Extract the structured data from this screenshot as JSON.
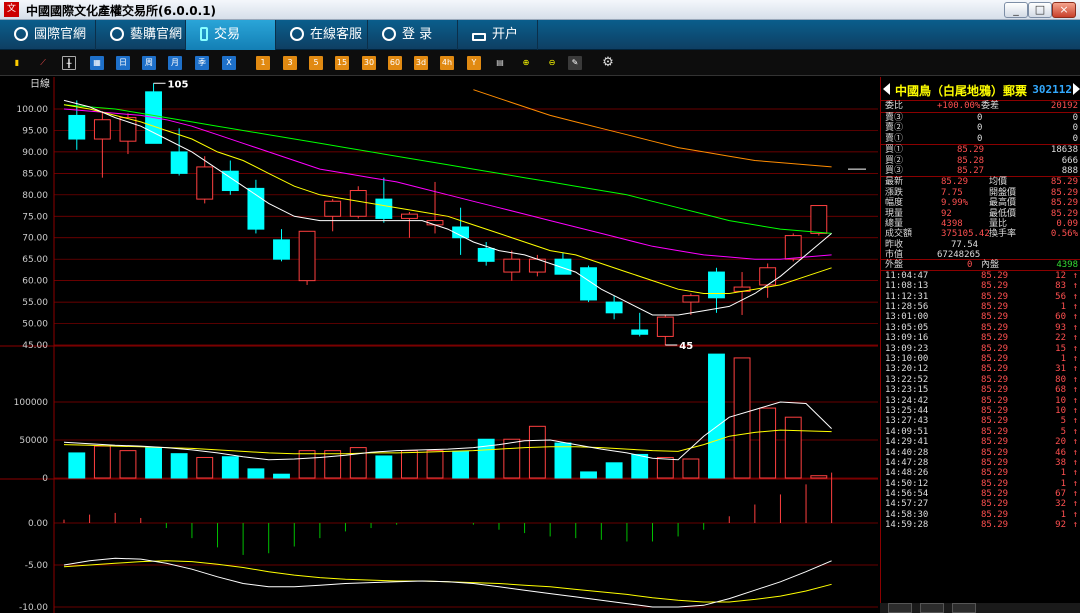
{
  "window": {
    "title": "中國國際文化產權交易所(6.0.0.1)",
    "app_icon_text": "文"
  },
  "nav": {
    "tabs": [
      {
        "label": "國際官網"
      },
      {
        "label": "藝購官網"
      },
      {
        "label": "交易"
      },
      {
        "label": "在線客服"
      },
      {
        "label": "登  录"
      },
      {
        "label": "开户"
      }
    ]
  },
  "toolbar": {
    "period_buttons": [
      "日",
      "周",
      "月",
      "季",
      "X"
    ],
    "minute_buttons": [
      "1",
      "3",
      "5",
      "15",
      "30",
      "60",
      "3d",
      "4h",
      "Y"
    ]
  },
  "chart": {
    "period_label": "日線",
    "max_label": "105",
    "min_label": "45",
    "y_ticks_price": [
      "100.00",
      "95.00",
      "90.00",
      "85.00",
      "80.00",
      "75.00",
      "70.00",
      "65.00",
      "60.00",
      "55.00",
      "50.00",
      "45.00"
    ],
    "y_ticks_volume": [
      "100000",
      "50000",
      "0"
    ],
    "y_ticks_macd": [
      "0.00",
      "-5.00",
      "-10.00"
    ]
  },
  "colors": {
    "rise": "#ff4040",
    "fall": "#00ffff",
    "ma5": "#ffffff",
    "ma10": "#ffff00",
    "ma20": "#ff00ff",
    "ma30": "#00ff00",
    "ma60": "#ff8c00",
    "grid": "#8b0000"
  },
  "chart_data": {
    "type": "candlestick",
    "title": "",
    "price_axis": [
      45,
      100
    ],
    "candles": [
      {
        "open": 98.5,
        "high": 102.0,
        "low": 90.5,
        "close": 93.0
      },
      {
        "open": 93.0,
        "high": 99.5,
        "low": 84.0,
        "close": 97.5
      },
      {
        "open": 92.5,
        "high": 99.0,
        "low": 89.5,
        "close": 98.0
      },
      {
        "open": 104.0,
        "high": 106.0,
        "low": 93.0,
        "close": 92.0
      },
      {
        "open": 90.0,
        "high": 95.5,
        "low": 84.5,
        "close": 85.0
      },
      {
        "open": 79.0,
        "high": 89.0,
        "low": 78.0,
        "close": 86.5
      },
      {
        "open": 85.5,
        "high": 88.0,
        "low": 80.0,
        "close": 81.0
      },
      {
        "open": 81.5,
        "high": 83.5,
        "low": 71.0,
        "close": 72.0
      },
      {
        "open": 69.5,
        "high": 72.0,
        "low": 64.5,
        "close": 65.0
      },
      {
        "open": 60.0,
        "high": 71.5,
        "low": 59.0,
        "close": 71.5
      },
      {
        "open": 75.0,
        "high": 79.0,
        "low": 71.5,
        "close": 78.5
      },
      {
        "open": 75.0,
        "high": 82.0,
        "low": 74.5,
        "close": 81.0
      },
      {
        "open": 79.0,
        "high": 84.0,
        "low": 73.5,
        "close": 74.5
      },
      {
        "open": 74.5,
        "high": 76.0,
        "low": 70.0,
        "close": 75.5
      },
      {
        "open": 73.0,
        "high": 83.0,
        "low": 71.0,
        "close": 74.0
      },
      {
        "open": 72.5,
        "high": 77.0,
        "low": 66.0,
        "close": 70.0
      },
      {
        "open": 67.5,
        "high": 69.0,
        "low": 63.5,
        "close": 64.5
      },
      {
        "open": 62.0,
        "high": 67.0,
        "low": 60.0,
        "close": 65.0
      },
      {
        "open": 62.0,
        "high": 66.0,
        "low": 61.0,
        "close": 65.0
      },
      {
        "open": 65.0,
        "high": 66.5,
        "low": 61.5,
        "close": 61.5
      },
      {
        "open": 63.0,
        "high": 63.5,
        "low": 55.0,
        "close": 55.5
      },
      {
        "open": 55.0,
        "high": 56.5,
        "low": 51.0,
        "close": 52.5
      },
      {
        "open": 48.5,
        "high": 52.5,
        "low": 47.0,
        "close": 47.5
      },
      {
        "open": 47.0,
        "high": 52.0,
        "low": 45.0,
        "close": 51.5
      },
      {
        "open": 55.0,
        "high": 57.0,
        "low": 52.0,
        "close": 56.5
      },
      {
        "open": 62.0,
        "high": 63.0,
        "low": 52.5,
        "close": 56.0
      },
      {
        "open": 57.5,
        "high": 62.0,
        "low": 52.0,
        "close": 58.5
      },
      {
        "open": 59.0,
        "high": 64.0,
        "low": 56.0,
        "close": 63.0
      },
      {
        "open": 65.0,
        "high": 71.0,
        "low": 64.5,
        "close": 70.5
      },
      {
        "open": 71.0,
        "high": 77.5,
        "low": 70.5,
        "close": 77.5
      }
    ],
    "volumes": [
      33000,
      42000,
      36000,
      40000,
      32000,
      27000,
      28000,
      12000,
      5000,
      36000,
      36000,
      40000,
      29000,
      36000,
      36000,
      35000,
      51000,
      51000,
      68000,
      46000,
      8000,
      20000,
      31000,
      27000,
      25000,
      163000,
      158000,
      92000,
      80000,
      3000
    ],
    "ma_price": {
      "ma5": [
        102,
        100.5,
        98,
        96,
        93,
        90,
        86,
        82,
        78,
        75,
        74,
        74,
        74,
        74,
        74,
        72,
        69,
        67,
        66,
        64,
        62,
        58,
        55,
        52,
        52,
        53,
        54,
        57,
        61,
        66,
        71
      ],
      "ma10": [
        101,
        100,
        98.5,
        97,
        95,
        93,
        90,
        88,
        85,
        82,
        80,
        79,
        78,
        77,
        76,
        75,
        73,
        71,
        69,
        67,
        66,
        64,
        62,
        60,
        58,
        57,
        57,
        58,
        59,
        61,
        63
      ],
      "ma20": [
        100,
        99.5,
        99,
        98.5,
        97.5,
        96,
        94,
        92,
        90,
        88,
        86,
        85,
        84,
        83,
        81.5,
        80,
        78.5,
        77,
        75.5,
        74,
        72.5,
        71,
        69.5,
        68,
        67,
        66,
        65.5,
        65,
        65,
        65.5,
        66
      ],
      "ma30": [
        101,
        100.5,
        100,
        99,
        98,
        97,
        96,
        95,
        94,
        93,
        92,
        91,
        90,
        89,
        88,
        87,
        86,
        85,
        84,
        83,
        82,
        81,
        80,
        78.5,
        77,
        75.5,
        74,
        73,
        72,
        71.5,
        71
      ],
      "ma60": [
        null,
        null,
        null,
        null,
        null,
        null,
        null,
        null,
        null,
        null,
        null,
        null,
        null,
        null,
        null,
        null,
        104.5,
        102.5,
        100.5,
        98.5,
        97,
        95.5,
        94,
        92.5,
        91,
        90,
        89,
        88,
        87.5,
        87,
        86.5
      ]
    },
    "ma_volume": {
      "ma5": [
        47000,
        45000,
        43000,
        42000,
        40000,
        37000,
        33000,
        28000,
        24000,
        25000,
        27000,
        30000,
        34000,
        36000,
        37000,
        38000,
        40000,
        44000,
        49000,
        50000,
        44000,
        38000,
        33000,
        26000,
        24000,
        55000,
        80000,
        90000,
        100000,
        98000,
        65000
      ],
      "ma10": [
        44000,
        43000,
        42000,
        41000,
        40000,
        39000,
        37000,
        35000,
        33000,
        32000,
        32000,
        32000,
        33000,
        33000,
        34000,
        35000,
        36000,
        38000,
        40000,
        41000,
        41000,
        40000,
        38000,
        36000,
        35000,
        44000,
        55000,
        60000,
        63000,
        62000,
        61000
      ]
    },
    "macd": {
      "dif": [
        -5.0,
        -4.5,
        -4.2,
        -4.3,
        -4.8,
        -5.5,
        -6.4,
        -7.2,
        -7.6,
        -7.6,
        -7.4,
        -7.2,
        -7.1,
        -7.0,
        -6.9,
        -7.0,
        -7.2,
        -7.6,
        -8.0,
        -8.4,
        -8.8,
        -9.2,
        -9.6,
        -10.0,
        -10.0,
        -9.8,
        -9.0,
        -8.0,
        -7.0,
        -5.8,
        -4.5
      ],
      "dea": [
        -5.2,
        -5.0,
        -4.8,
        -4.6,
        -4.5,
        -4.6,
        -4.9,
        -5.3,
        -5.8,
        -6.2,
        -6.5,
        -6.7,
        -6.8,
        -6.9,
        -6.9,
        -7.0,
        -7.1,
        -7.2,
        -7.4,
        -7.6,
        -7.9,
        -8.2,
        -8.5,
        -8.9,
        -9.2,
        -9.4,
        -9.4,
        -9.1,
        -8.7,
        -8.1,
        -7.3
      ],
      "hist": [
        0.4,
        1.0,
        1.2,
        0.6,
        -0.6,
        -1.8,
        -2.9,
        -3.8,
        -3.6,
        -2.8,
        -1.8,
        -1.0,
        -0.6,
        -0.2,
        0,
        0,
        -0.2,
        -0.8,
        -1.2,
        -1.6,
        -1.8,
        -2.0,
        -2.2,
        -2.2,
        -1.6,
        -0.8,
        0.8,
        2.2,
        3.4,
        4.6,
        6.0
      ]
    },
    "xlabel": "",
    "ylabel": ""
  },
  "quote": {
    "name": "中國鳥（白尾地鴉）郵票",
    "code": "302112",
    "weibi_label": "委比",
    "weibi_value": "+100.00%",
    "weicha_label": "委差",
    "weicha_value": "20192",
    "sell": [
      {
        "label": "賣③",
        "price": "0",
        "vol": "0"
      },
      {
        "label": "賣②",
        "price": "0",
        "vol": "0"
      },
      {
        "label": "賣①",
        "price": "0",
        "vol": "0"
      }
    ],
    "buy": [
      {
        "label": "買①",
        "price": "85.29",
        "vol": "18638"
      },
      {
        "label": "買②",
        "price": "85.28",
        "vol": "666"
      },
      {
        "label": "買③",
        "price": "85.27",
        "vol": "888"
      }
    ],
    "stats": [
      {
        "l1": "最新",
        "v1": "85.29",
        "l2": "均價",
        "v2": "85.29"
      },
      {
        "l1": "漲跌",
        "v1": "7.75",
        "l2": "開盤價",
        "v2": "85.29"
      },
      {
        "l1": "幅度",
        "v1": "9.99%",
        "l2": "最高價",
        "v2": "85.29"
      },
      {
        "l1": "現量",
        "v1": "92",
        "l2": "最低價",
        "v2": "85.29"
      },
      {
        "l1": "總量",
        "v1": "4398",
        "l2": "量比",
        "v2": "0.09"
      },
      {
        "l1": "成交額",
        "v1": "375105.42",
        "l2": "換手率",
        "v2": "0.56%"
      }
    ],
    "prev_close_label": "昨收",
    "prev_close": "77.54",
    "mkt_cap_label": "市值",
    "mkt_cap": "67248265",
    "outer_label": "外盤",
    "outer_value": "0",
    "inner_label": "內盤",
    "inner_value": "4398",
    "ticks": [
      {
        "time": "11:04:47",
        "price": "85.29",
        "vol": "12"
      },
      {
        "time": "11:08:13",
        "price": "85.29",
        "vol": "83"
      },
      {
        "time": "11:12:31",
        "price": "85.29",
        "vol": "56"
      },
      {
        "time": "11:28:56",
        "price": "85.29",
        "vol": "1"
      },
      {
        "time": "13:01:00",
        "price": "85.29",
        "vol": "60"
      },
      {
        "time": "13:05:05",
        "price": "85.29",
        "vol": "93"
      },
      {
        "time": "13:09:16",
        "price": "85.29",
        "vol": "22"
      },
      {
        "time": "13:09:23",
        "price": "85.29",
        "vol": "15"
      },
      {
        "time": "13:10:00",
        "price": "85.29",
        "vol": "1"
      },
      {
        "time": "13:20:12",
        "price": "85.29",
        "vol": "31"
      },
      {
        "time": "13:22:52",
        "price": "85.29",
        "vol": "80"
      },
      {
        "time": "13:23:15",
        "price": "85.29",
        "vol": "68"
      },
      {
        "time": "13:24:42",
        "price": "85.29",
        "vol": "10"
      },
      {
        "time": "13:25:44",
        "price": "85.29",
        "vol": "10"
      },
      {
        "time": "13:27:43",
        "price": "85.29",
        "vol": "5"
      },
      {
        "time": "14:09:51",
        "price": "85.29",
        "vol": "5"
      },
      {
        "time": "14:29:41",
        "price": "85.29",
        "vol": "20"
      },
      {
        "time": "14:40:28",
        "price": "85.29",
        "vol": "46"
      },
      {
        "time": "14:47:28",
        "price": "85.29",
        "vol": "38"
      },
      {
        "time": "14:48:26",
        "price": "85.29",
        "vol": "1"
      },
      {
        "time": "14:50:12",
        "price": "85.29",
        "vol": "1"
      },
      {
        "time": "14:56:54",
        "price": "85.29",
        "vol": "67"
      },
      {
        "time": "14:57:27",
        "price": "85.29",
        "vol": "32"
      },
      {
        "time": "14:58:30",
        "price": "85.29",
        "vol": "1"
      },
      {
        "time": "14:59:28",
        "price": "85.29",
        "vol": "92"
      }
    ],
    "tick_arrow": "↑"
  }
}
